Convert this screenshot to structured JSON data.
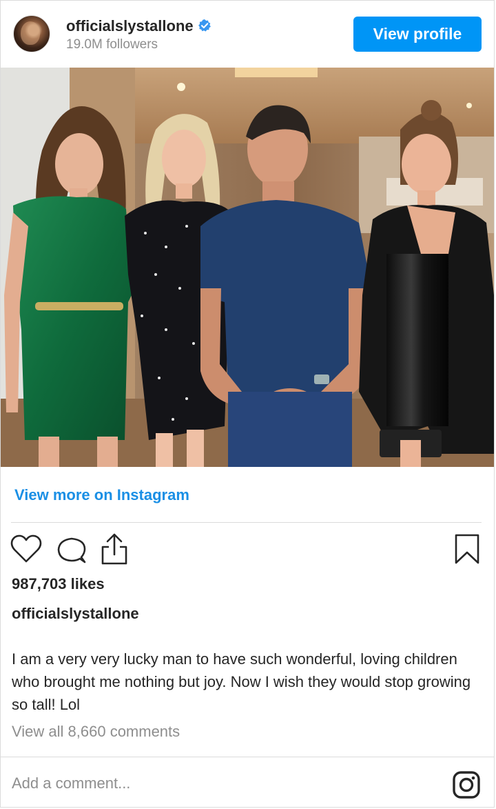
{
  "header": {
    "username": "officialslystallone",
    "verified_icon": "verified-badge-icon",
    "followers": "19.0M followers",
    "view_profile_label": "View profile"
  },
  "photo": {
    "icon": "photo"
  },
  "links": {
    "view_more": "View more on Instagram"
  },
  "actions": {
    "like_icon": "heart-icon",
    "comment_icon": "comment-icon",
    "share_icon": "share-icon",
    "save_icon": "bookmark-icon"
  },
  "post": {
    "likes": "987,703 likes",
    "caption_user": "officialslystallone",
    "caption": "I am a very very lucky man to have such wonderful, loving children who brought me nothing but joy. Now I wish they would stop growing so tall! Lol",
    "view_comments": "View all 8,660 comments"
  },
  "comment_box": {
    "placeholder": "Add a comment...",
    "icon": "instagram-icon"
  },
  "colors": {
    "accent": "#0095f6",
    "link": "#1a8fe5",
    "muted": "#8e8e8e",
    "text": "#262626"
  }
}
